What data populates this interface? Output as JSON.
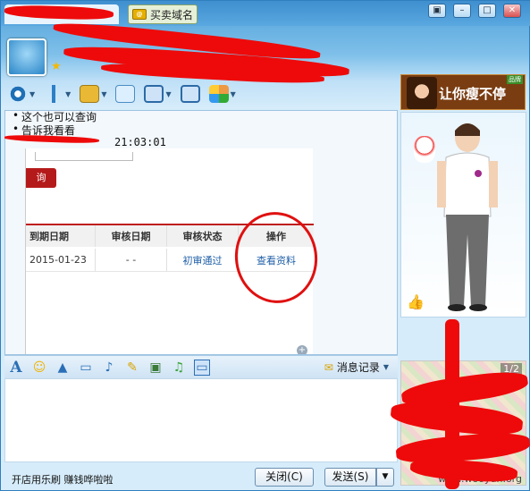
{
  "tabs": {
    "active_label": "",
    "second_label": "买卖域名",
    "second_icon": "domain-icon"
  },
  "window_controls": [
    "restore-icon",
    "minimize-icon",
    "maximize-icon",
    "close-icon"
  ],
  "toolbar": {
    "icons": [
      "video-icon",
      "voice-icon",
      "file-transfer-icon",
      "sms-icon",
      "remote-desktop-icon",
      "screen-share-icon",
      "apps-icon"
    ]
  },
  "ad_banner": {
    "text": "让你瘦不停",
    "tag": "品牌"
  },
  "chat": {
    "lines": [
      "这个也可以查询",
      "告诉我看看"
    ],
    "sender_time": "21:03:01",
    "shot": {
      "query_button": "询",
      "columns": [
        "到期日期",
        "审核日期",
        "审核状态",
        "操作"
      ],
      "rows": [
        {
          "expire": "2015-01-23",
          "review_date": "- -",
          "review_status": "初审通过",
          "action": "查看资料"
        }
      ]
    }
  },
  "input_toolbar": {
    "icons": [
      "font-icon",
      "emoji-icon",
      "shake-icon",
      "video-clip-icon",
      "voice-message-icon",
      "sticky-note-icon",
      "image-icon",
      "music-icon",
      "screenshot-icon"
    ],
    "history_label": "消息记录"
  },
  "footer": {
    "promo_text": "开店用乐刷 赚钱哗啦啦",
    "close_label": "关闭(C)",
    "send_label": "发送(S)"
  },
  "side_panel": {
    "page_indicator": "1/2",
    "watermark": "www.wooyun.org"
  }
}
